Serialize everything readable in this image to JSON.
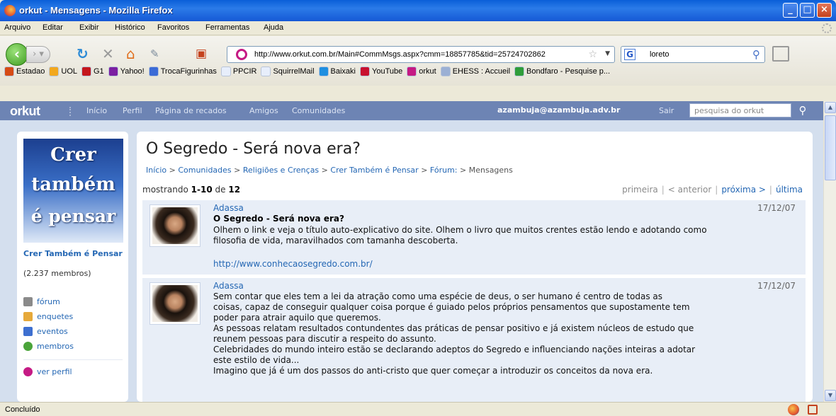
{
  "window": {
    "title": "orkut - Mensagens - Mozilla Firefox",
    "minimize": "_",
    "maximize": "□",
    "close": "×"
  },
  "menu": [
    "Arquivo",
    "Editar",
    "Exibir",
    "Histórico",
    "Favoritos",
    "Ferramentas",
    "Ajuda"
  ],
  "nav": {
    "url": "http://www.orkut.com.br/Main#CommMsgs.aspx?cmm=18857785&tid=25724702862",
    "search_value": "loreto"
  },
  "bookmarks": [
    {
      "label": "Estadao",
      "color": "#d64b16"
    },
    {
      "label": "UOL",
      "color": "#f2a81d"
    },
    {
      "label": "G1",
      "color": "#c4161c"
    },
    {
      "label": "Yahoo!",
      "color": "#7b1fa2"
    },
    {
      "label": "TrocaFigurinhas",
      "color": "#3b6bd6"
    },
    {
      "label": "PPCIR",
      "color": "#e7eefb"
    },
    {
      "label": "SquirrelMail",
      "color": "#e7eefb"
    },
    {
      "label": "Baixaki",
      "color": "#1f8fe0"
    },
    {
      "label": "YouTube",
      "color": "#c8102e"
    },
    {
      "label": "orkut",
      "color": "#c51a84"
    },
    {
      "label": "EHESS : Accueil",
      "color": "#9bb0d4"
    },
    {
      "label": "Bondfaro - Pesquise p...",
      "color": "#2f9d3a"
    }
  ],
  "orkut": {
    "logo": "orkut",
    "nav": [
      "Início",
      "Perfil",
      "Página de recados",
      "Amigos",
      "Comunidades"
    ],
    "email": "azambuja@azambuja.adv.br",
    "logout": "Sair",
    "search_placeholder": "pesquisa do orkut"
  },
  "community": {
    "cover_lines": [
      "Crer",
      "também",
      "é pensar"
    ],
    "name": "Crer Também é Pensar",
    "members": "(2.237 membros)",
    "links": [
      {
        "label": "fórum",
        "icon": "forum-icon",
        "color": "#8a8a8a"
      },
      {
        "label": "enquetes",
        "icon": "poll-icon",
        "color": "#e6a93a"
      },
      {
        "label": "eventos",
        "icon": "calendar-icon",
        "color": "#3d6fd0"
      },
      {
        "label": "membros",
        "icon": "members-icon",
        "color": "#4aa43a"
      }
    ],
    "profile_link": "ver perfil"
  },
  "main": {
    "title": "O Segredo - Será nova era?",
    "breadcrumbs": [
      "Início",
      "Comunidades",
      "Religiões e Crenças",
      "Crer Também é Pensar",
      "Fórum:",
      "Mensagens"
    ],
    "showing_prefix": "mostrando",
    "showing_range": "1-10",
    "showing_of": "de",
    "showing_total": "12",
    "pager": {
      "first": "primeira",
      "prev": "< anterior",
      "next": "próxima >",
      "last": "última"
    }
  },
  "messages": [
    {
      "author": "Adassa",
      "date": "17/12/07",
      "subject": "O Segredo - Será nova era?",
      "body": [
        "Olhem o link e veja o título auto-explicativo do site. Olhem o livro que muitos crentes estão lendo e adotando como",
        "filosofia de vida, maravilhados com tamanha descoberta."
      ],
      "link": "http://www.conhecaosegredo.com.br/"
    },
    {
      "author": "Adassa",
      "date": "17/12/07",
      "body": [
        "Sem contar que eles tem a lei da atração como uma espécie de deus, o ser humano é centro de todas as",
        "coisas, capaz de conseguir qualquer coisa porque é guiado pelos próprios pensamentos que supostamente tem",
        "poder para atrair aquilo que queremos.",
        "As pessoas relatam resultados contundentes das práticas de pensar positivo e já existem núcleos de estudo que",
        "reunem pessoas para discutir a respeito do assunto.",
        "Celebridades do mundo inteiro estão se declarando adeptos do Segredo e influenciando nações inteiras a adotar",
        "este estilo de vida...",
        "Imagino que já é um dos passos do anti-cristo que quer começar a introduzir os conceitos da nova era."
      ]
    }
  ],
  "status": {
    "text": "Concluído"
  }
}
